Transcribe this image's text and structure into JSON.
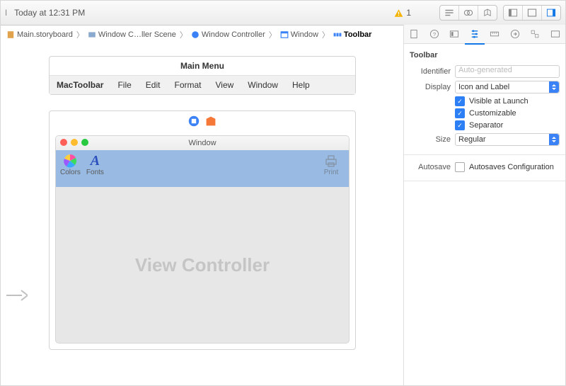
{
  "top": {
    "date": "Today at 12:31 PM",
    "warning_count": "1"
  },
  "jump": {
    "crumb0": "Main.storyboard",
    "crumb1": "Window C…ller Scene",
    "crumb2": "Window Controller",
    "crumb3": "Window",
    "crumb4": "Toolbar"
  },
  "inspector": {
    "section_title": "Toolbar",
    "identifier_label": "Identifier",
    "identifier_placeholder": "Auto-generated",
    "display_label": "Display",
    "display_value": "Icon and Label",
    "visible_label": "Visible at Launch",
    "customizable_label": "Customizable",
    "separator_label": "Separator",
    "size_label": "Size",
    "size_value": "Regular",
    "autosave_label": "Autosave",
    "autosave_chk_label": "Autosaves Configuration"
  },
  "menu": {
    "title": "Main Menu",
    "item0": "MacToolbar",
    "item1": "File",
    "item2": "Edit",
    "item3": "Format",
    "item4": "View",
    "item5": "Window",
    "item6": "Help"
  },
  "window": {
    "title": "Window",
    "colors": "Colors",
    "fonts": "Fonts",
    "print": "Print",
    "vc": "View Controller"
  }
}
